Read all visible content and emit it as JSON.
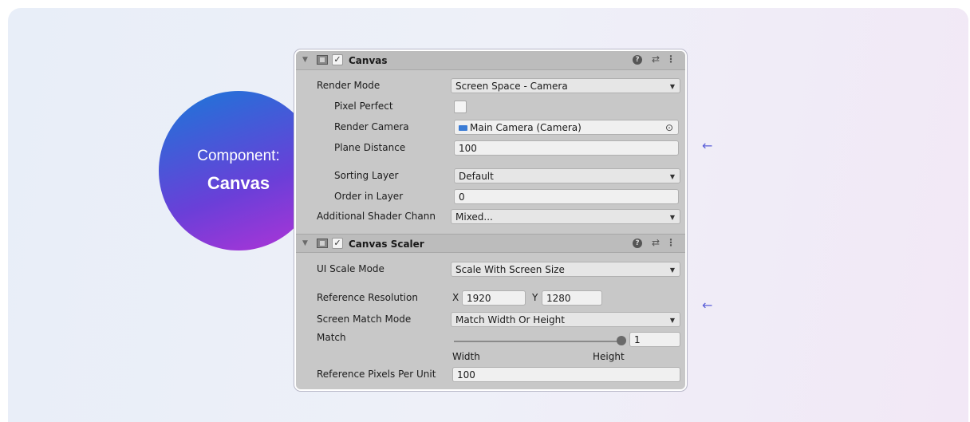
{
  "badge": {
    "line1": "Component:",
    "line2": "Canvas"
  },
  "canvas": {
    "header": {
      "title": "Canvas",
      "check": "✓",
      "help": "?",
      "preset": "⇄",
      "menu": "⋮"
    },
    "render_mode": {
      "label": "Render Mode",
      "value": "Screen Space - Camera"
    },
    "pixel_perfect": {
      "label": "Pixel Perfect"
    },
    "render_camera": {
      "label": "Render Camera",
      "value": "Main Camera (Camera)"
    },
    "plane_distance": {
      "label": "Plane Distance",
      "value": "100"
    },
    "sorting_layer": {
      "label": "Sorting Layer",
      "value": "Default"
    },
    "order_in_layer": {
      "label": "Order in Layer",
      "value": "0"
    },
    "additional_shader": {
      "label": "Additional Shader Chann",
      "value": "Mixed..."
    }
  },
  "scaler": {
    "header": {
      "title": "Canvas Scaler",
      "check": "✓",
      "help": "?",
      "preset": "⇄",
      "menu": "⋮"
    },
    "ui_scale_mode": {
      "label": "UI Scale Mode",
      "value": "Scale With Screen Size"
    },
    "reference_resolution": {
      "label": "Reference Resolution",
      "x_label": "X",
      "x": "1920",
      "y_label": "Y",
      "y": "1280"
    },
    "screen_match_mode": {
      "label": "Screen Match Mode",
      "value": "Match Width Or Height"
    },
    "match": {
      "label": "Match",
      "value": "1",
      "min_label": "Width",
      "max_label": "Height",
      "fraction": 1.0
    },
    "ref_pixels": {
      "label": "Reference Pixels Per Unit",
      "value": "100"
    }
  },
  "annotations": {
    "arrow": "←"
  },
  "colors": {
    "accent": "#5b5fd8",
    "badge_start": "#1a78d8",
    "badge_end": "#b233d6"
  }
}
